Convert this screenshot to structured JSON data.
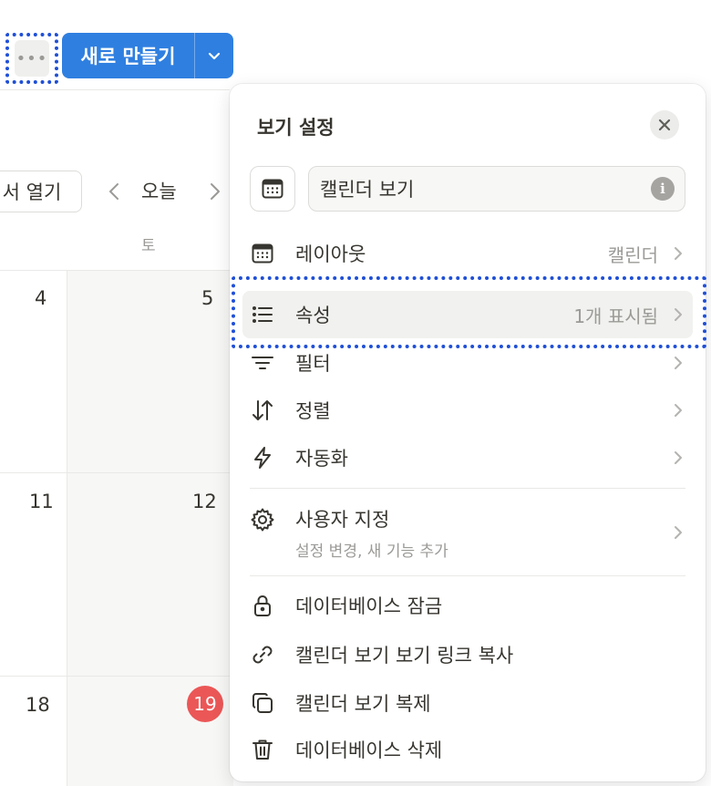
{
  "toolbar": {
    "more_label": "•••",
    "new_label": "새로 만들기"
  },
  "calendar": {
    "open_label": "서 열기",
    "today_label": "오늘",
    "weekday": "토",
    "days": [
      "4",
      "5",
      "11",
      "12",
      "18",
      "19"
    ],
    "today_day": "19",
    "today_color": "#eb5757"
  },
  "panel": {
    "title": "보기 설정",
    "view_name": "캘린더 보기",
    "items": [
      {
        "label": "레이아웃",
        "value": "캘린더",
        "icon": "calendar-icon"
      },
      {
        "label": "속성",
        "value": "1개 표시됨",
        "icon": "list-icon"
      },
      {
        "label": "필터",
        "value": "",
        "icon": "filter-icon"
      },
      {
        "label": "정렬",
        "value": "",
        "icon": "sort-icon"
      },
      {
        "label": "자동화",
        "value": "",
        "icon": "lightning-icon"
      }
    ],
    "customize": {
      "label": "사용자 지정",
      "sub": "설정 변경, 새 기능 추가",
      "icon": "gear-icon"
    },
    "actions": [
      {
        "label": "데이터베이스 잠금",
        "icon": "lock-icon"
      },
      {
        "label": "캘린더 보기 보기 링크 복사",
        "icon": "link-icon"
      },
      {
        "label": "캘린더 보기 복제",
        "icon": "duplicate-icon"
      },
      {
        "label": "데이터베이스 삭제",
        "icon": "trash-icon"
      }
    ]
  },
  "colors": {
    "accent": "#2f7fe0",
    "highlight": "#1f4fd6"
  }
}
